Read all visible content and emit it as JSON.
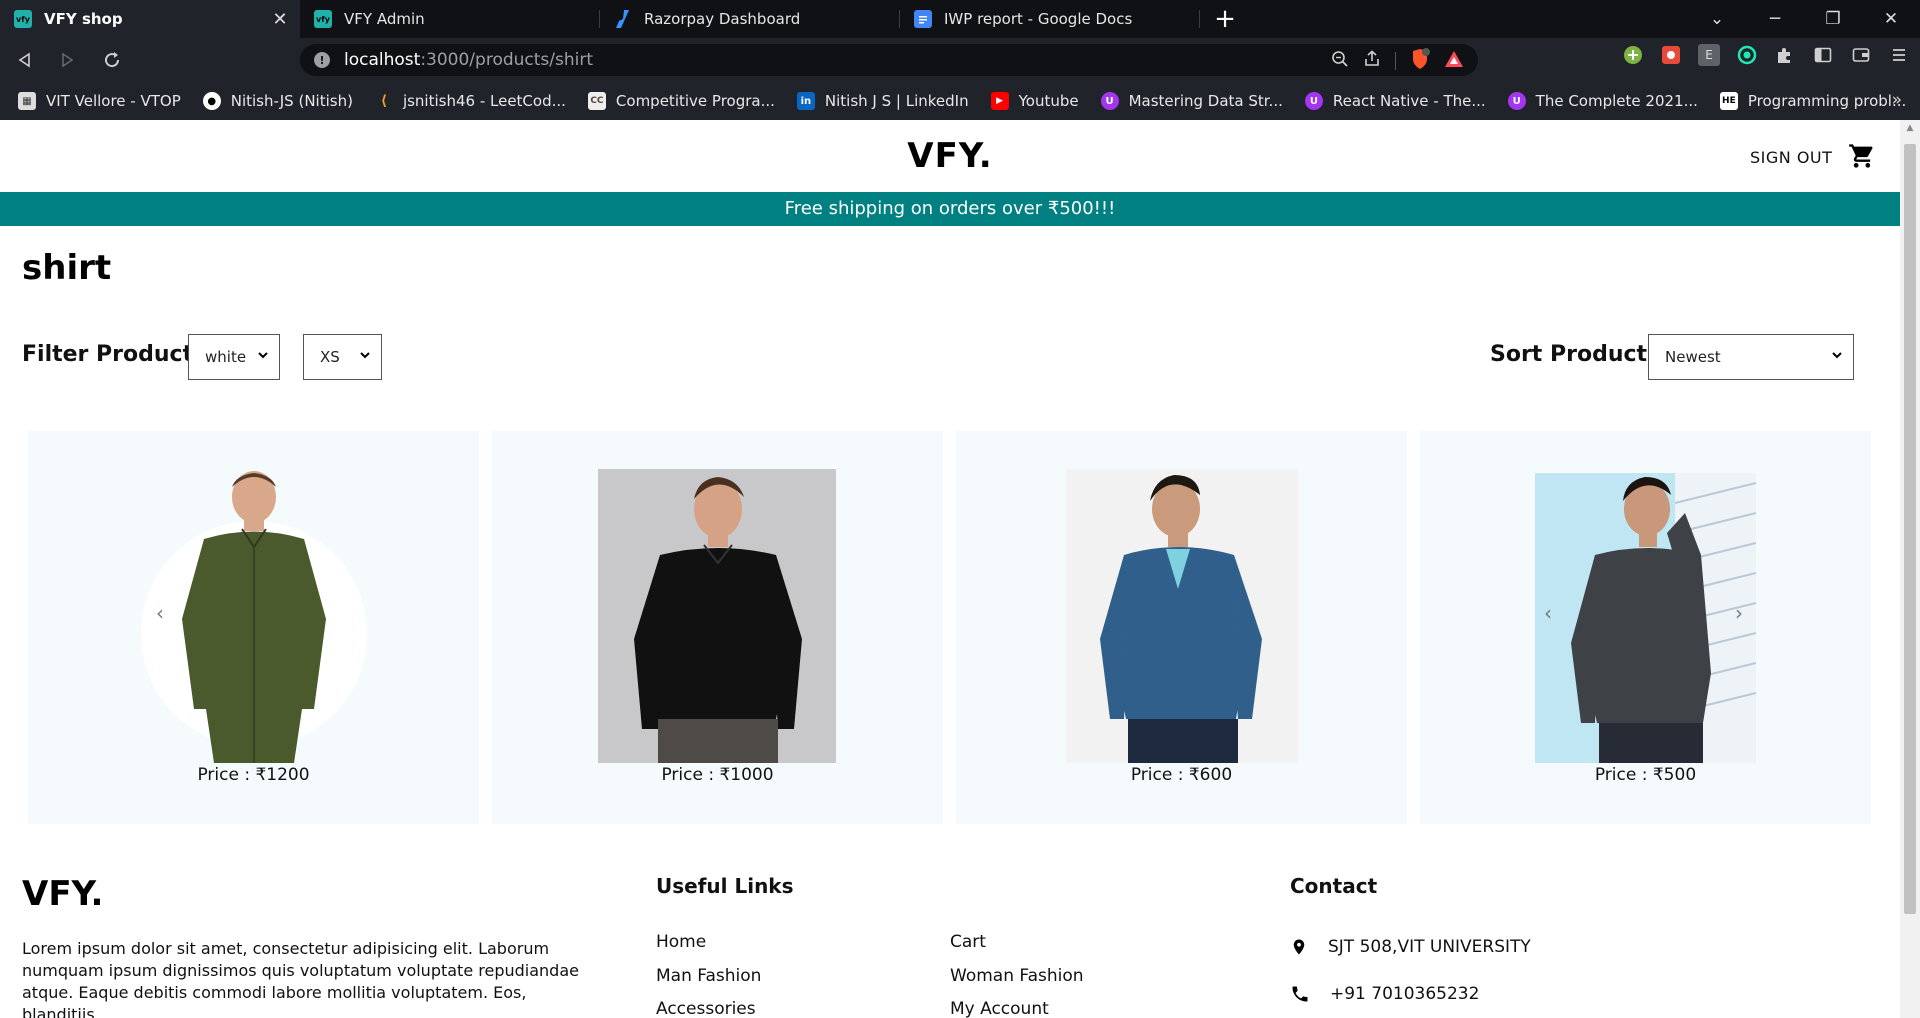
{
  "browser": {
    "tabs": [
      {
        "title": "VFY shop",
        "active": true,
        "close": "✕"
      },
      {
        "title": "VFY Admin",
        "active": false
      },
      {
        "title": "Razorpay Dashboard",
        "active": false
      },
      {
        "title": "IWP report - Google Docs",
        "active": false
      }
    ],
    "new_tab": "+",
    "address": {
      "host": "localhost",
      "path": ":3000/products/shirt"
    },
    "bookmarks": [
      "VIT Vellore - VTOP",
      "Nitish-JS (Nitish)",
      "jsnitish46 - LeetCod...",
      "Competitive Progra...",
      "Nitish J S | LinkedIn",
      "Youtube",
      "Mastering Data Str...",
      "React Native - The...",
      "The Complete 2021...",
      "Programming probl..."
    ],
    "bookmarks_more": "»"
  },
  "site": {
    "logo": "VFY.",
    "sign_out": "SIGN OUT",
    "announcement": "Free shipping on orders over ₹500!!!",
    "page_title": "shirt",
    "filter_label": "Filter Products",
    "filter_color": "white",
    "filter_size": "XS",
    "sort_label": "Sort Products",
    "sort_value": "Newest",
    "products": [
      {
        "price": "Price : ₹1200",
        "shirt_color": "#4a5a2c"
      },
      {
        "price": "Price : ₹1000",
        "shirt_color": "#111111"
      },
      {
        "price": "Price : ₹600",
        "shirt_color": "#2f5f8a"
      },
      {
        "price": "Price : ₹500",
        "shirt_color": "#3e4247"
      }
    ],
    "carousel_prev": "‹",
    "carousel_next": "›"
  },
  "footer": {
    "logo": "VFY.",
    "description": "Lorem ipsum dolor sit amet, consectetur adipisicing elit. Laborum numquam ipsum dignissimos quis voluptatum voluptate repudiandae atque. Eaque debitis commodi labore mollitia voluptatem. Eos, blanditiis.",
    "useful_links_title": "Useful Links",
    "links_col1": [
      "Home",
      "Man Fashion",
      "Accessories"
    ],
    "links_col2": [
      "Cart",
      "Woman Fashion",
      "My Account"
    ],
    "contact_title": "Contact",
    "address": "SJT 508,VIT UNIVERSITY",
    "phone": "+91 7010365232"
  },
  "colors": {
    "accent": "#008080",
    "card_bg": "#f5fbfd"
  }
}
